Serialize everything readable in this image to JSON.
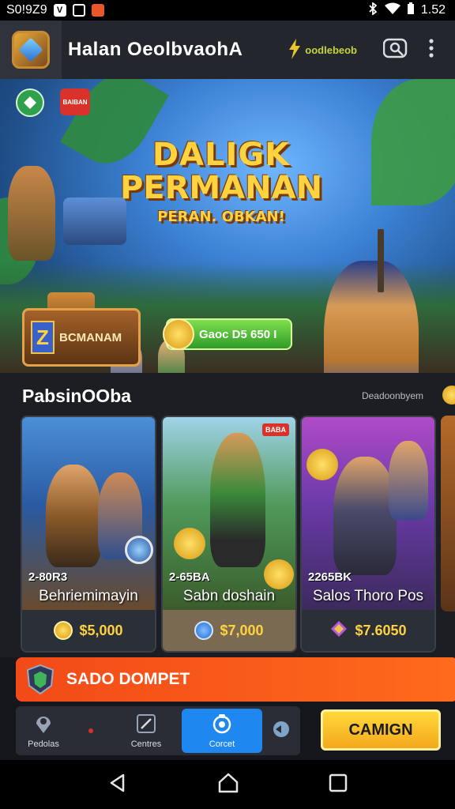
{
  "status_bar": {
    "left_text": "S0!9Z9",
    "time": "1.52"
  },
  "header": {
    "title": "Halan OeolbvaohA",
    "promo_label": "oodlebeob",
    "icons": [
      "app-logo-icon",
      "lightning-icon",
      "search-icon",
      "more-vert-icon"
    ]
  },
  "hero": {
    "badge_red_text": "BAIBAN",
    "title_line1": "DALIGK",
    "title_line2": "PERMANAN",
    "subtitle": "PERAN. OBKAN!",
    "chest_letter": "Z",
    "chest_label": "BCMANAM",
    "cta_label": "Gaoc D5 650 I"
  },
  "section": {
    "title": "PabsinOOba",
    "link": "Deadoonbyem",
    "cards": [
      {
        "level": "2-80R3",
        "name": "Behriemimayin",
        "price": "$5,000",
        "tag": ""
      },
      {
        "level": "2-65BA",
        "name": "Sabn doshain",
        "price": "$7,000",
        "tag": "BABA"
      },
      {
        "level": "2265BK",
        "name": "Salos Thoro Pos",
        "price": "$7.6050",
        "tag": ""
      }
    ]
  },
  "wallet": {
    "label": "SADO DOMPET"
  },
  "bottom_nav": {
    "items": [
      {
        "label": "Pedolas",
        "icon": "map-pin-icon"
      },
      {
        "label": "",
        "icon": "notification-dot"
      },
      {
        "label": "Centres",
        "icon": "edit-icon"
      },
      {
        "label": "Corcet",
        "icon": "gamepad-icon"
      },
      {
        "label": "",
        "icon": "chat-icon"
      }
    ],
    "campaign_label": "CAMIGN"
  },
  "colors": {
    "accent_orange": "#f24a18",
    "accent_blue": "#1e88f0",
    "gold": "#ffd23f",
    "cta_green": "#2f9b28"
  }
}
